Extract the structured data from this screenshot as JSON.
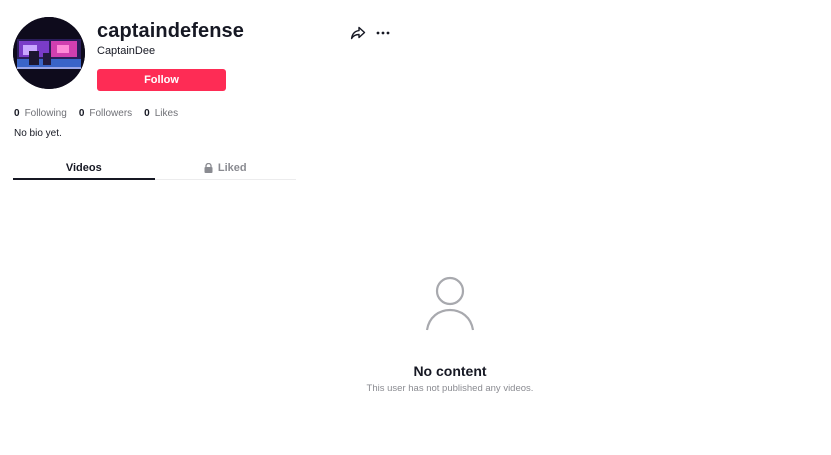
{
  "profile": {
    "username": "captaindefense",
    "nickname": "CaptainDee",
    "follow_label": "Follow",
    "bio": "No bio yet.",
    "avatar_icon": "avatar-image"
  },
  "actions": {
    "share_icon": "share-icon",
    "more_icon": "more-icon"
  },
  "stats": {
    "following": {
      "count": "0",
      "label": "Following"
    },
    "followers": {
      "count": "0",
      "label": "Followers"
    },
    "likes": {
      "count": "0",
      "label": "Likes"
    }
  },
  "tabs": [
    {
      "label": "Videos",
      "active": true
    },
    {
      "label": "Liked",
      "active": false,
      "icon": "lock-icon"
    }
  ],
  "empty_state": {
    "icon": "user-icon",
    "title": "No content",
    "subtitle": "This user has not published any videos."
  },
  "colors": {
    "accent": "#fe2c55",
    "text": "#161823",
    "muted": "#8a8b91"
  }
}
